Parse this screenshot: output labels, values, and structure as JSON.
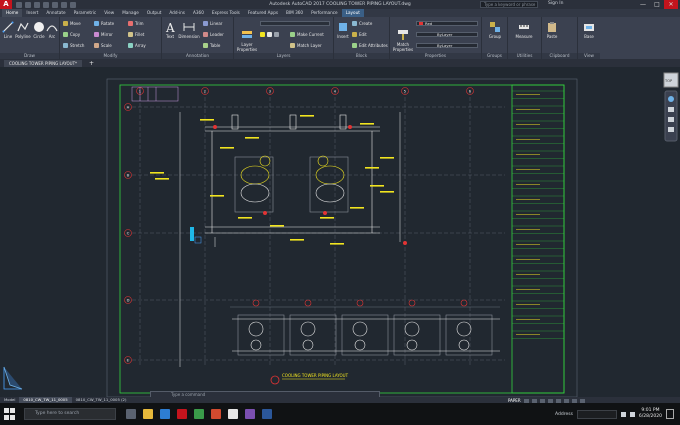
{
  "window": {
    "title": "Autodesk AutoCAD 2017    COOLING TOWER PIPING LAYOUT.dwg",
    "search_placeholder": "Type a keyword or phrase",
    "sign_in": "Sign In",
    "min": "—",
    "max": "□",
    "close": "✕"
  },
  "ribbon_tabs": [
    "Home",
    "Insert",
    "Annotate",
    "Parametric",
    "View",
    "Manage",
    "Output",
    "Add-ins",
    "A360",
    "Express Tools",
    "Featured Apps",
    "BIM 360",
    "Performance",
    "Layout"
  ],
  "panels": {
    "draw": {
      "title": "Draw",
      "line": "Line",
      "polyline": "Polyline",
      "circle": "Circle",
      "arc": "Arc"
    },
    "modify": {
      "title": "Modify",
      "move": "Move",
      "rotate": "Rotate",
      "trim": "Trim",
      "copy": "Copy",
      "mirror": "Mirror",
      "fillet": "Fillet",
      "stretch": "Stretch",
      "scale": "Scale",
      "array": "Array"
    },
    "annotation": {
      "title": "Annotation",
      "text": "Text",
      "dimension": "Dimension",
      "linear": "Linear",
      "leader": "Leader",
      "table": "Table"
    },
    "layers": {
      "title": "Layers",
      "layer_properties": "Layer Properties",
      "make_current": "Make Current",
      "match_layer": "Match Layer"
    },
    "block": {
      "title": "Block",
      "insert": "Insert",
      "create": "Create",
      "edit": "Edit",
      "edit_attributes": "Edit Attributes"
    },
    "properties": {
      "title": "Properties",
      "match_properties": "Match Properties",
      "color": "Red",
      "linetype": "ByLayer",
      "lineweight": "ByLayer"
    },
    "groups": {
      "title": "Groups",
      "group": "Group"
    },
    "utilities": {
      "title": "Utilities",
      "measure": "Measure"
    },
    "clipboard": {
      "title": "Clipboard",
      "paste": "Paste"
    },
    "view": {
      "title": "View",
      "base": "Base"
    }
  },
  "file_tabs": [
    "COOLING TOWER PIPING LAYOUT*",
    "+"
  ],
  "drawing": {
    "title_block_header": "COOLING TOWER PIPING LAYOUT",
    "column_markers": [
      "1",
      "2",
      "3",
      "4",
      "5",
      "6",
      "7",
      "8"
    ],
    "row_markers": [
      "A",
      "B",
      "C",
      "D",
      "E"
    ]
  },
  "layout_tabs": [
    "Model",
    "0810_CW_TW_11_0005",
    "0810_CW_TW_11_0005 (2)"
  ],
  "command_line": {
    "placeholder": "Type a command"
  },
  "status": {
    "model": "PAPER"
  },
  "taskbar": {
    "search_placeholder": "Type here to search",
    "address_label": "Address",
    "time": "9:01 PM",
    "date": "6/28/2020"
  },
  "colors": {
    "accent": "#c4141d",
    "canvas": "#212830",
    "drawing_line": "#33d33f",
    "cad_yellow": "#f2e51f"
  }
}
